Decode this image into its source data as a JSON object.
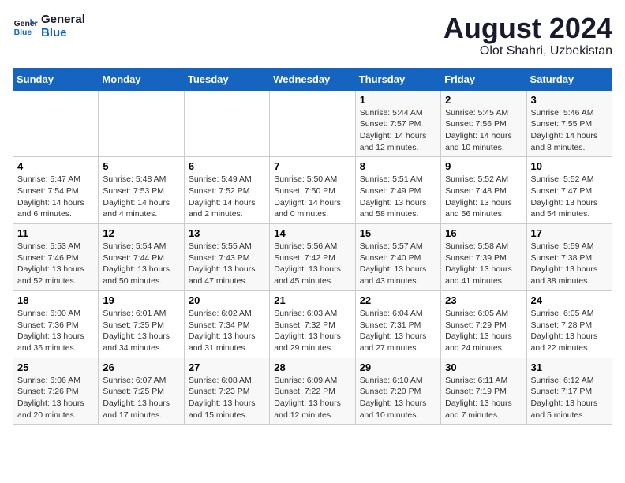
{
  "logo": {
    "line1": "General",
    "line2": "Blue"
  },
  "title": "August 2024",
  "location": "Olot Shahri, Uzbekistan",
  "weekdays": [
    "Sunday",
    "Monday",
    "Tuesday",
    "Wednesday",
    "Thursday",
    "Friday",
    "Saturday"
  ],
  "weeks": [
    [
      {
        "day": "",
        "detail": ""
      },
      {
        "day": "",
        "detail": ""
      },
      {
        "day": "",
        "detail": ""
      },
      {
        "day": "",
        "detail": ""
      },
      {
        "day": "1",
        "detail": "Sunrise: 5:44 AM\nSunset: 7:57 PM\nDaylight: 14 hours\nand 12 minutes."
      },
      {
        "day": "2",
        "detail": "Sunrise: 5:45 AM\nSunset: 7:56 PM\nDaylight: 14 hours\nand 10 minutes."
      },
      {
        "day": "3",
        "detail": "Sunrise: 5:46 AM\nSunset: 7:55 PM\nDaylight: 14 hours\nand 8 minutes."
      }
    ],
    [
      {
        "day": "4",
        "detail": "Sunrise: 5:47 AM\nSunset: 7:54 PM\nDaylight: 14 hours\nand 6 minutes."
      },
      {
        "day": "5",
        "detail": "Sunrise: 5:48 AM\nSunset: 7:53 PM\nDaylight: 14 hours\nand 4 minutes."
      },
      {
        "day": "6",
        "detail": "Sunrise: 5:49 AM\nSunset: 7:52 PM\nDaylight: 14 hours\nand 2 minutes."
      },
      {
        "day": "7",
        "detail": "Sunrise: 5:50 AM\nSunset: 7:50 PM\nDaylight: 14 hours\nand 0 minutes."
      },
      {
        "day": "8",
        "detail": "Sunrise: 5:51 AM\nSunset: 7:49 PM\nDaylight: 13 hours\nand 58 minutes."
      },
      {
        "day": "9",
        "detail": "Sunrise: 5:52 AM\nSunset: 7:48 PM\nDaylight: 13 hours\nand 56 minutes."
      },
      {
        "day": "10",
        "detail": "Sunrise: 5:52 AM\nSunset: 7:47 PM\nDaylight: 13 hours\nand 54 minutes."
      }
    ],
    [
      {
        "day": "11",
        "detail": "Sunrise: 5:53 AM\nSunset: 7:46 PM\nDaylight: 13 hours\nand 52 minutes."
      },
      {
        "day": "12",
        "detail": "Sunrise: 5:54 AM\nSunset: 7:44 PM\nDaylight: 13 hours\nand 50 minutes."
      },
      {
        "day": "13",
        "detail": "Sunrise: 5:55 AM\nSunset: 7:43 PM\nDaylight: 13 hours\nand 47 minutes."
      },
      {
        "day": "14",
        "detail": "Sunrise: 5:56 AM\nSunset: 7:42 PM\nDaylight: 13 hours\nand 45 minutes."
      },
      {
        "day": "15",
        "detail": "Sunrise: 5:57 AM\nSunset: 7:40 PM\nDaylight: 13 hours\nand 43 minutes."
      },
      {
        "day": "16",
        "detail": "Sunrise: 5:58 AM\nSunset: 7:39 PM\nDaylight: 13 hours\nand 41 minutes."
      },
      {
        "day": "17",
        "detail": "Sunrise: 5:59 AM\nSunset: 7:38 PM\nDaylight: 13 hours\nand 38 minutes."
      }
    ],
    [
      {
        "day": "18",
        "detail": "Sunrise: 6:00 AM\nSunset: 7:36 PM\nDaylight: 13 hours\nand 36 minutes."
      },
      {
        "day": "19",
        "detail": "Sunrise: 6:01 AM\nSunset: 7:35 PM\nDaylight: 13 hours\nand 34 minutes."
      },
      {
        "day": "20",
        "detail": "Sunrise: 6:02 AM\nSunset: 7:34 PM\nDaylight: 13 hours\nand 31 minutes."
      },
      {
        "day": "21",
        "detail": "Sunrise: 6:03 AM\nSunset: 7:32 PM\nDaylight: 13 hours\nand 29 minutes."
      },
      {
        "day": "22",
        "detail": "Sunrise: 6:04 AM\nSunset: 7:31 PM\nDaylight: 13 hours\nand 27 minutes."
      },
      {
        "day": "23",
        "detail": "Sunrise: 6:05 AM\nSunset: 7:29 PM\nDaylight: 13 hours\nand 24 minutes."
      },
      {
        "day": "24",
        "detail": "Sunrise: 6:05 AM\nSunset: 7:28 PM\nDaylight: 13 hours\nand 22 minutes."
      }
    ],
    [
      {
        "day": "25",
        "detail": "Sunrise: 6:06 AM\nSunset: 7:26 PM\nDaylight: 13 hours\nand 20 minutes."
      },
      {
        "day": "26",
        "detail": "Sunrise: 6:07 AM\nSunset: 7:25 PM\nDaylight: 13 hours\nand 17 minutes."
      },
      {
        "day": "27",
        "detail": "Sunrise: 6:08 AM\nSunset: 7:23 PM\nDaylight: 13 hours\nand 15 minutes."
      },
      {
        "day": "28",
        "detail": "Sunrise: 6:09 AM\nSunset: 7:22 PM\nDaylight: 13 hours\nand 12 minutes."
      },
      {
        "day": "29",
        "detail": "Sunrise: 6:10 AM\nSunset: 7:20 PM\nDaylight: 13 hours\nand 10 minutes."
      },
      {
        "day": "30",
        "detail": "Sunrise: 6:11 AM\nSunset: 7:19 PM\nDaylight: 13 hours\nand 7 minutes."
      },
      {
        "day": "31",
        "detail": "Sunrise: 6:12 AM\nSunset: 7:17 PM\nDaylight: 13 hours\nand 5 minutes."
      }
    ]
  ]
}
